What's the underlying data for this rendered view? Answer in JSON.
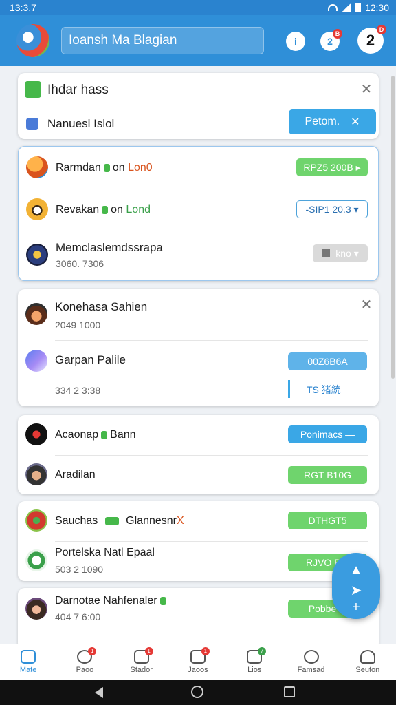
{
  "status_bar": {
    "time": "13:3.7",
    "clock": "12:30"
  },
  "app_bar": {
    "search_text": "Ioansh Ma Blagian",
    "icon2_badge": "B",
    "icon3_label": "2",
    "icon3_badge": "D"
  },
  "card1": {
    "title": "Ihdar hass",
    "subtitle": "Nanuesl Islol",
    "button_label": "Petom.",
    "button_x": "✕"
  },
  "card2": {
    "rows": [
      {
        "name": "Rarmdan",
        "on": "on",
        "accent": "Lon0",
        "pill": "RPZ5 200B ▸"
      },
      {
        "name": "Revakan",
        "on": "on",
        "accent": "Lond",
        "pill": "-SIP1 20.3 ▾"
      },
      {
        "name": "Memclaslemdssrapa",
        "sub": "3060. 7306",
        "pill": "kno ▾"
      }
    ]
  },
  "card3": {
    "row1": {
      "name": "Konehasa Sahien",
      "sub": "2049 1000"
    },
    "row2": {
      "name": "Garpan Palile",
      "pill": "00Z6B6A",
      "sub": "334 2 3:38",
      "status": "TS 猪統"
    }
  },
  "card4": {
    "row1": {
      "name": "Acaonap",
      "extra": "Bann",
      "pill": "Ponimacs —"
    },
    "row2": {
      "name": "Aradilan",
      "pill": "RGT B10G"
    }
  },
  "card5": {
    "row1": {
      "name": "Sauchas",
      "extra": "Glannesnr",
      "accent": "X",
      "pill": "DTHGT5"
    },
    "row2": {
      "name": "Portelska Natl Epaal",
      "sub": "503 2 1090",
      "pill": "RJVO BIF"
    }
  },
  "card6": {
    "row1": {
      "name": "Darnotae Nahfenaler",
      "sub": "404 7 6:00",
      "pill": "Pobbe"
    }
  },
  "bottom_nav": [
    {
      "label": "Mate",
      "badge": ""
    },
    {
      "label": "Paoo",
      "badge": "1"
    },
    {
      "label": "Stador",
      "badge": "1"
    },
    {
      "label": "Jaoos",
      "badge": "1"
    },
    {
      "label": "Lios",
      "badge": "7"
    },
    {
      "label": "Famsad",
      "badge": ""
    },
    {
      "label": "Seuton",
      "badge": ""
    }
  ],
  "colors": {
    "primary": "#2f8fd8",
    "accent_green": "#6fd46d",
    "accent_blue": "#3aa7e6"
  },
  "icons": [
    "wifi-icon",
    "signal-icon",
    "battery-icon",
    "search-icon",
    "home-icon",
    "back-icon"
  ]
}
